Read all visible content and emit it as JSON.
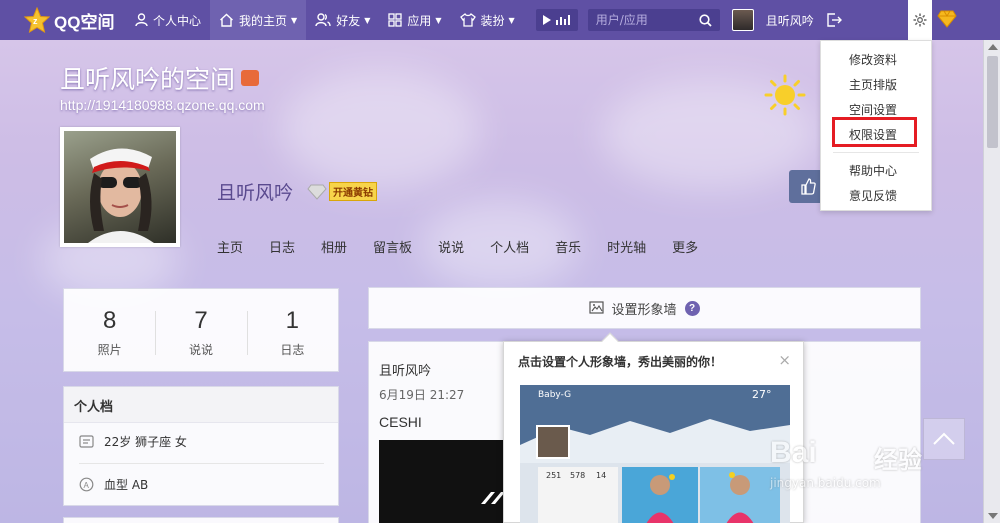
{
  "topbar": {
    "logo_text": "QQ空间",
    "nav": [
      {
        "label": "个人中心",
        "icon": "person-icon",
        "dropdown": false
      },
      {
        "label": "我的主页",
        "icon": "home-icon",
        "dropdown": true
      },
      {
        "label": "好友",
        "icon": "friends-icon",
        "dropdown": true
      },
      {
        "label": "应用",
        "icon": "apps-grid-icon",
        "dropdown": true
      },
      {
        "label": "装扮",
        "icon": "shirt-icon",
        "dropdown": true
      }
    ],
    "search_placeholder": "用户/应用",
    "username": "且听风吟",
    "bar_color": "#5f50a4"
  },
  "header": {
    "space_title": "且听风吟的空间",
    "space_url": "http://1914180988.qzone.qq.com",
    "nickname": "且听风吟",
    "vip_badge": "开通黄钻",
    "tabs": [
      "主页",
      "日志",
      "相册",
      "留言板",
      "说说",
      "个人档",
      "音乐",
      "时光轴",
      "更多"
    ]
  },
  "settings_menu": {
    "items": [
      "修改资料",
      "主页排版",
      "空间设置",
      "权限设置",
      "帮助中心",
      "意见反馈"
    ],
    "highlighted": "权限设置",
    "highlight_color": "#e51c23"
  },
  "stats": [
    {
      "value": "8",
      "label": "照片"
    },
    {
      "value": "7",
      "label": "说说"
    },
    {
      "value": "1",
      "label": "日志"
    }
  ],
  "profile": {
    "title": "个人档",
    "info": "22岁  狮子座  女",
    "blood": "血型 AB"
  },
  "image_wall": {
    "label": "设置形象墙"
  },
  "feed": {
    "author": "且听风吟",
    "time": "6月19日 21:27",
    "body": "CESHI"
  },
  "popup": {
    "title": "点击设置个人形象墙，秀出美丽的你！",
    "close": "×",
    "preview": {
      "name": "Baby-G",
      "temp": "27°",
      "stats": [
        "251",
        "578",
        "14"
      ]
    }
  },
  "watermark": {
    "brand": "Bai",
    "cn": "经验",
    "url": "jingyan.baidu.com"
  }
}
